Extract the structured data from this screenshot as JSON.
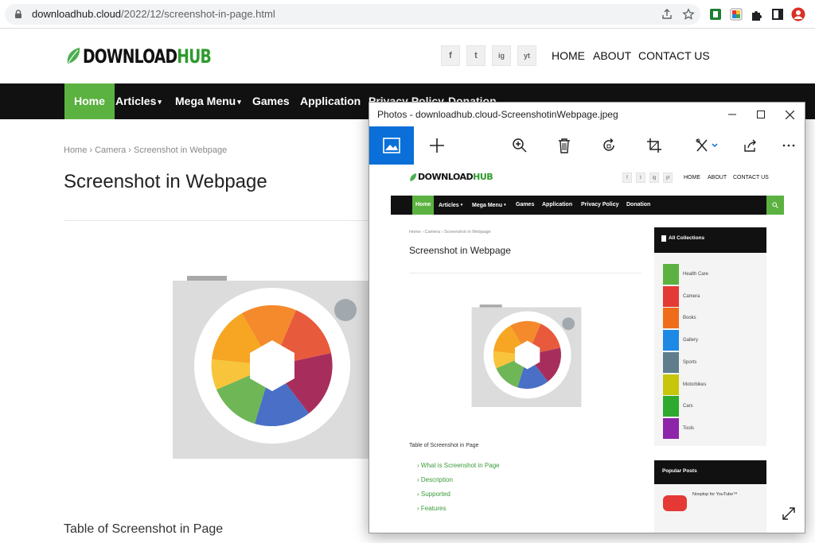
{
  "browser": {
    "url_host": "downloadhub.cloud",
    "url_path": "/2022/12/screenshot-in-page.html"
  },
  "site": {
    "logo": {
      "part1": "DOWNLOAD",
      "part2": "HUB"
    },
    "social": [
      "f",
      "t",
      "ig",
      "yt"
    ],
    "topnav": [
      "HOME",
      "ABOUT",
      "CONTACT US"
    ],
    "mainnav": [
      {
        "label": "Home",
        "caret": ""
      },
      {
        "label": "Articles",
        "caret": "▾"
      },
      {
        "label": "Mega Menu",
        "caret": "▾"
      },
      {
        "label": "Games",
        "caret": ""
      },
      {
        "label": "Application",
        "caret": ""
      },
      {
        "label": "Privacy Policy",
        "caret": ""
      },
      {
        "label": "Donation",
        "caret": ""
      }
    ],
    "breadcrumb": "Home › Camera › Screenshot in Webpage",
    "page_title": "Screenshot in Webpage",
    "toc_title": "Table of Screenshot in Page"
  },
  "photos": {
    "title": "Photos - downloadhub.cloud-ScreenshotinWebpage.jpeg",
    "mini": {
      "logo": {
        "part1": "DOWNLOAD",
        "part2": "HUB"
      },
      "topnav": [
        "HOME",
        "ABOUT",
        "CONTACT US"
      ],
      "nav": [
        {
          "label": "Home",
          "caret": ""
        },
        {
          "label": "Articles",
          "caret": "▾"
        },
        {
          "label": "Mega Menu",
          "caret": "▾"
        },
        {
          "label": "Games",
          "caret": ""
        },
        {
          "label": "Application",
          "caret": ""
        },
        {
          "label": "Privacy Policy",
          "caret": ""
        },
        {
          "label": "Donation",
          "caret": ""
        }
      ],
      "breadcrumb": "Home › Camera › Screenshot in Webpage",
      "title": "Screenshot in Webpage",
      "toc_title": "Table of Screenshot in Page",
      "toc": [
        "What is Screenshot in Page",
        "Description",
        "Supported",
        "Features"
      ],
      "sidebar_title": "All Collections",
      "categories": [
        {
          "label": "Health Care",
          "color": "#5bb240"
        },
        {
          "label": "Camera",
          "color": "#e53935"
        },
        {
          "label": "Books",
          "color": "#ef6c1a"
        },
        {
          "label": "Gallery",
          "color": "#1e88e5"
        },
        {
          "label": "Sports",
          "color": "#607d8b"
        },
        {
          "label": "Motorbikes",
          "color": "#c6c60a"
        },
        {
          "label": "Cars",
          "color": "#2eaa2e"
        },
        {
          "label": "Tools",
          "color": "#8e24aa"
        }
      ],
      "popular_title": "Popular Posts",
      "popular_item": "Noxplop for YouTube™"
    }
  }
}
